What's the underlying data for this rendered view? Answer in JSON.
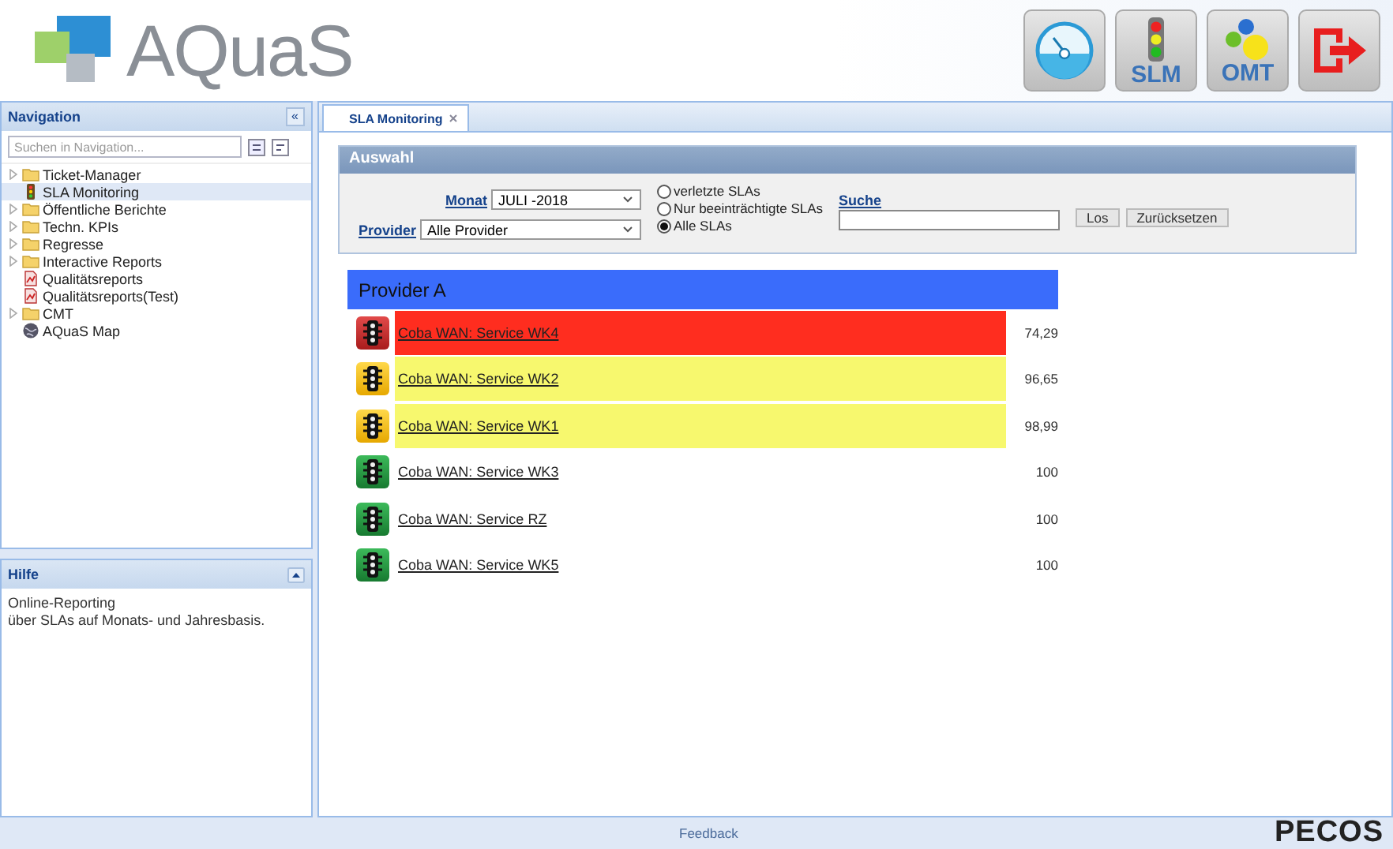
{
  "header": {
    "logo": "AQuaS",
    "toolbar": [
      {
        "kind": "gauge"
      },
      {
        "kind": "traffic",
        "label": "SLM"
      },
      {
        "kind": "gears",
        "label": "OMT"
      },
      {
        "kind": "exit"
      }
    ]
  },
  "navigation": {
    "title": "Navigation",
    "collapse": "«",
    "search": {
      "placeholder": "Suchen in Navigation..."
    },
    "items": [
      {
        "label": "Ticket-Manager",
        "kind": "folder",
        "expanded": false,
        "selected": false
      },
      {
        "label": "SLA Monitoring",
        "kind": "traffic",
        "selected": true
      },
      {
        "label": "Öffentliche Berichte",
        "kind": "folder",
        "expanded": false,
        "selected": false
      },
      {
        "label": "Techn. KPIs",
        "kind": "folder",
        "expanded": false,
        "selected": false
      },
      {
        "label": "Regresse",
        "kind": "folder",
        "expanded": false,
        "selected": false
      },
      {
        "label": "Interactive Reports",
        "kind": "folder",
        "expanded": false,
        "selected": false
      },
      {
        "label": "Qualitätsreports",
        "kind": "report",
        "selected": false
      },
      {
        "label": "Qualitätsreports(Test)",
        "kind": "report",
        "selected": false
      },
      {
        "label": "CMT",
        "kind": "folder",
        "expanded": false,
        "selected": false
      },
      {
        "label": "AQuaS Map",
        "kind": "map",
        "selected": false
      }
    ]
  },
  "help": {
    "title": "Hilfe",
    "lines": [
      "Online-Reporting",
      "über SLAs auf Monats- und Jahresbasis."
    ]
  },
  "tabs": [
    {
      "label": "SLA Monitoring",
      "selected": true
    }
  ],
  "filter": {
    "title": "Auswahl",
    "month_label": "Monat",
    "month": "JULI -2018",
    "provider_label": "Provider",
    "provider": "Alle Provider",
    "options": [
      {
        "label": "verletzte SLAs",
        "selected": false
      },
      {
        "label": "Nur beeinträchtigte SLAs",
        "selected": false
      },
      {
        "label": "Alle SLAs",
        "selected": true
      }
    ],
    "search_label": "Suche",
    "buttons": [
      "Los",
      "Zurücksetzen"
    ]
  },
  "provider": {
    "name": "Provider A",
    "rows": [
      {
        "service": "Coba WAN: Service WK4",
        "value": "74,29",
        "kind": "red"
      },
      {
        "service": "Coba WAN: Service WK2",
        "value": "96,65",
        "kind": "yellow"
      },
      {
        "service": "Coba WAN: Service WK1",
        "value": "98,99",
        "kind": "yellow"
      },
      {
        "service": "Coba WAN: Service WK3",
        "value": "100",
        "kind": "green"
      },
      {
        "service": "Coba WAN: Service RZ",
        "value": "100",
        "kind": "green"
      },
      {
        "service": "Coba WAN: Service WK5",
        "value": "100",
        "kind": "green"
      }
    ]
  },
  "footer": {
    "link": "Feedback",
    "brand": "PECOS"
  }
}
